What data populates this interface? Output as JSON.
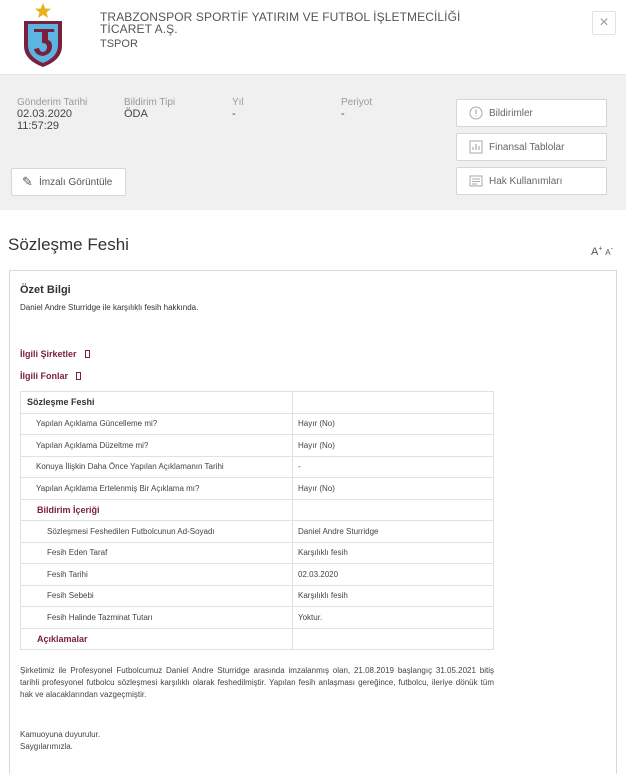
{
  "header": {
    "company_lines": [
      "TRABZONSPOR SPORTİF YATIRIM VE FUTBOL İŞLETMECİLİĞİ",
      "TİCARET A.Ş."
    ],
    "ticker": "TSPOR",
    "close_label": "×",
    "brand_colors": {
      "maroon": "#7a1f3d",
      "blue": "#5bb5e0",
      "gold": "#e8b21e"
    }
  },
  "meta": {
    "send_date_label": "Gönderim Tarihi",
    "send_date": "02.03.2020",
    "send_time": "11:57:29",
    "type_label": "Bildirim Tipi",
    "type_value": "ÖDA",
    "year_label": "Yıl",
    "year_value": "-",
    "period_label": "Periyot",
    "period_value": "-",
    "signed_label": "İmzalı Görüntüle",
    "buttons": [
      {
        "label": "Bildirimler",
        "icon": "alert-circle-icon"
      },
      {
        "label": "Finansal Tablolar",
        "icon": "chart-icon"
      },
      {
        "label": "Hak Kullanımları",
        "icon": "document-icon"
      }
    ]
  },
  "page": {
    "title": "Sözleşme Feshi",
    "font_inc": "A",
    "font_inc_sup": "+",
    "font_dec": "A",
    "font_dec_sup": "-"
  },
  "summary": {
    "title": "Özet Bilgi",
    "text": "Daniel Andre Sturridge ile karşılıklı fesih hakkında."
  },
  "related": {
    "companies": "İlgili Şirketler",
    "funds": "İlgili Fonlar"
  },
  "table": {
    "header": "Sözleşme Feshi",
    "rows": [
      {
        "label": "Yapılan Açıklama Güncelleme mi?",
        "value": "Hayır (No)"
      },
      {
        "label": "Yapılan Açıklama Düzeltme mi?",
        "value": "Hayır (No)"
      },
      {
        "label": "Konuya İlişkin Daha Önce Yapılan Açıklamanın Tarihi",
        "value": "-"
      },
      {
        "label": "Yapılan Açıklama Ertelenmiş Bir Açıklama mı?",
        "value": "Hayır (No)"
      }
    ],
    "subheader": "Bildirim İçeriği",
    "content_rows": [
      {
        "label": "Sözleşmesi Feshedilen Futbolcunun Ad-Soyadı",
        "value": "Daniel Andre Sturridge"
      },
      {
        "label": "Fesih Eden Taraf",
        "value": "Karşılıklı fesih"
      },
      {
        "label": "Fesih Tarihi",
        "value": "02.03.2020"
      },
      {
        "label": "Fesih Sebebi",
        "value": "Karşılıklı fesih"
      },
      {
        "label": "Fesih Halinde Tazminat Tutarı",
        "value": "Yoktur."
      }
    ],
    "explanations_label": "Açıklamalar"
  },
  "explanation": {
    "paragraph": "Şirketimiz ile Profesyonel Futbolcumuz Daniel Andre Sturridge arasında imzalanmış olan, 21.08.2019 başlangıç 31.05.2021 bitiş tarihli profesyonel futbolcu sözleşmesi karşılıklı olarak feshedilmiştir. Yapılan fesih anlaşması gereğince, futbolcu, ileriye dönük tüm hak ve alacaklarından vazgeçmiştir.",
    "closing_1": "Kamuoyuna duyurulur.",
    "closing_2": "Saygılarımızla."
  }
}
